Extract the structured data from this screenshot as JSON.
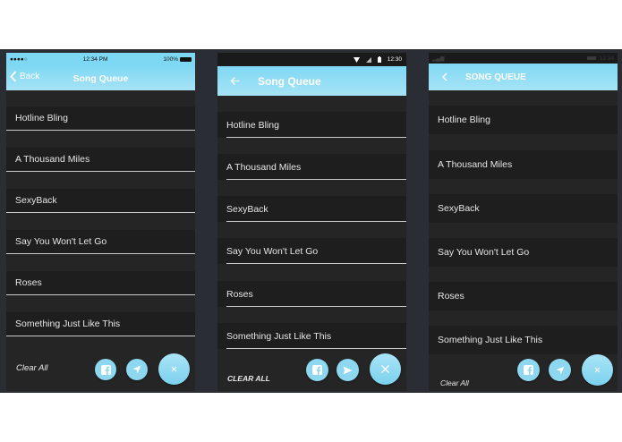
{
  "colors": {
    "accent_top": "#7fd8f3",
    "accent_bottom": "#a6e3f6",
    "panel": "#1e1e1e",
    "background": "#252525"
  },
  "songs": [
    "Hotline Bling",
    "A Thousand Miles",
    "SexyBack",
    "Say You Won't Let Go",
    "Roses",
    "Something Just Like This"
  ],
  "ios": {
    "status": {
      "carrier": "●●●●○",
      "time": "12:34 PM",
      "battery": "100%"
    },
    "back_label": "Back",
    "title": "Song Queue",
    "clear_all": "Clear All"
  },
  "android": {
    "status": {
      "time": "12:30"
    },
    "title": "Song Queue",
    "clear_all": "CLEAR ALL"
  },
  "windows": {
    "status": {
      "time": "12:34"
    },
    "title": "SONG QUEUE",
    "clear_all": "Clear All"
  },
  "icons": [
    "facebook-icon",
    "send-icon",
    "close-icon",
    "back-arrow-icon"
  ]
}
